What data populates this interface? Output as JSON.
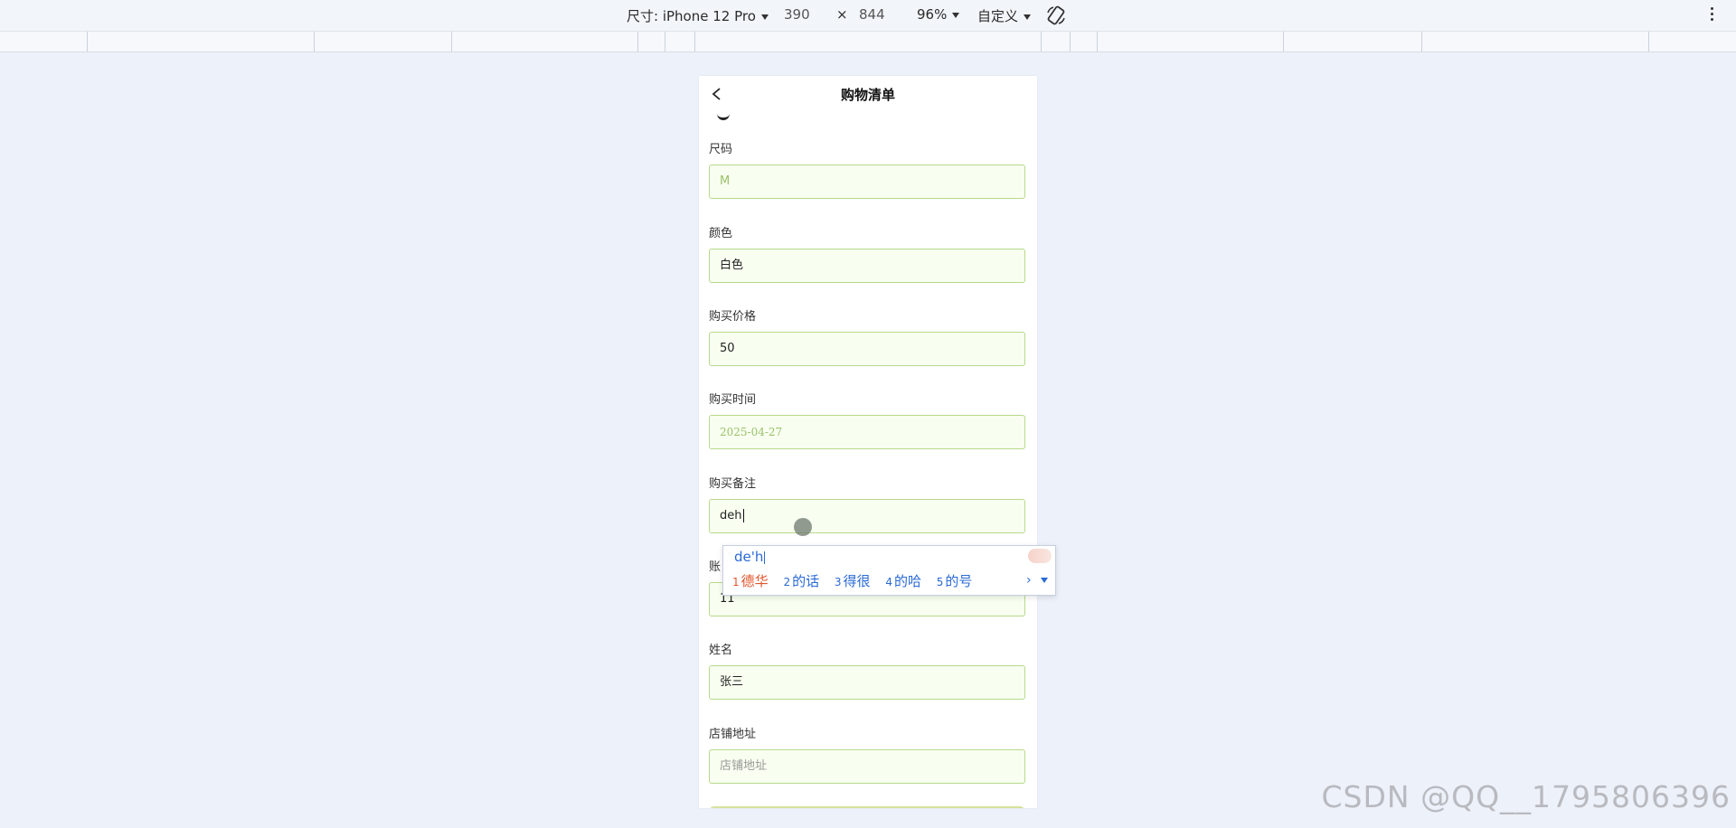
{
  "devtools": {
    "device_label": "尺寸: iPhone 12 Pro",
    "width_value": "390",
    "times_symbol": "×",
    "height_value": "844",
    "zoom_label": "96%",
    "throttle_label": "自定义"
  },
  "page": {
    "title": "购物清单",
    "fields": [
      {
        "label": "尺码",
        "value": "M",
        "state": "placeholder"
      },
      {
        "label": "颜色",
        "value": "白色",
        "state": "filled"
      },
      {
        "label": "购买价格",
        "value": "50",
        "state": "filled"
      },
      {
        "label": "购买时间",
        "value": "2025-04-27",
        "state": "placeholder"
      },
      {
        "label": "购买备注",
        "value": "deh",
        "state": "focused"
      },
      {
        "label": "账",
        "value": "11",
        "state": "filled"
      },
      {
        "label": "姓名",
        "value": "张三",
        "state": "filled"
      },
      {
        "label": "店铺地址",
        "value": "店铺地址",
        "state": "placeholder"
      }
    ]
  },
  "ime": {
    "composition": "de'h",
    "candidates": [
      {
        "index": "1",
        "text": "德华"
      },
      {
        "index": "2",
        "text": "的话"
      },
      {
        "index": "3",
        "text": "得很"
      },
      {
        "index": "4",
        "text": "的哈"
      },
      {
        "index": "5",
        "text": "的号"
      }
    ],
    "more_symbol": "›"
  },
  "watermark": "CSDN @QQ__1795806396",
  "colors": {
    "input_border": "#b8d98a",
    "input_bg": "#f8fff0",
    "ime_text": "#2a6ad6",
    "ime_active": "#e2552c"
  }
}
